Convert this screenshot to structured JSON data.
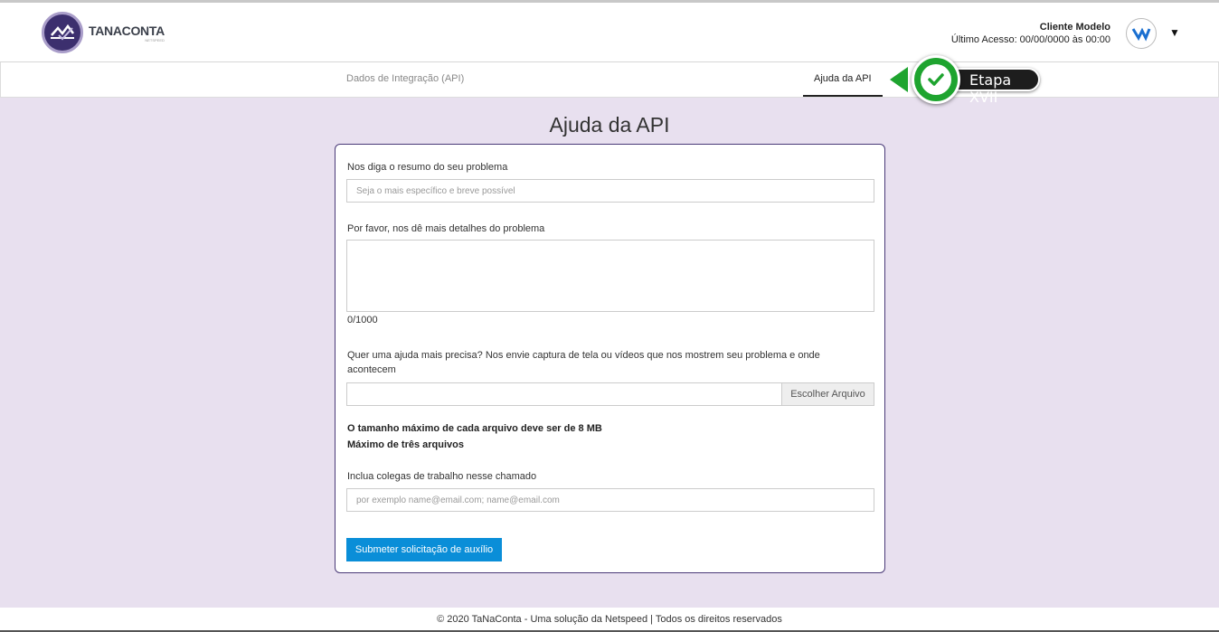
{
  "brand": {
    "name": "TANACONTA",
    "sub": "NETSPEED"
  },
  "user": {
    "name": "Cliente Modelo",
    "last_access": "Último Acesso: 00/00/0000 às 00:00"
  },
  "nav": {
    "tabs": [
      {
        "label": "Dados de Integração (API)"
      },
      {
        "label": "Ajuda da API"
      }
    ]
  },
  "callout": {
    "label": "Etapa XVII",
    "color": "#1ea42f"
  },
  "page": {
    "title": "Ajuda da API"
  },
  "form": {
    "summary_label": "Nos diga o resumo do seu problema",
    "summary_placeholder": "Seja o mais específico e breve possível",
    "details_label": "Por favor, nos dê mais detalhes do problema",
    "details_counter": "0/1000",
    "attach_label": "Quer uma ajuda mais precisa? Nos envie captura de tela ou vídeos que nos mostrem seu problema e onde acontecem",
    "attach_button": "Escolher Arquivo",
    "max_size_note": "O tamanho máximo de cada arquivo deve ser de 8 MB",
    "max_files_note": "Máximo de três arquivos",
    "colleagues_label": "Inclua colegas de trabalho nesse chamado",
    "colleagues_placeholder": "por exemplo name@email.com; name@email.com",
    "submit_label": "Submeter solicitação de auxílio"
  },
  "footer": {
    "text": "© 2020 TaNaConta - Uma solução da Netspeed | Todos os direitos reservados"
  }
}
